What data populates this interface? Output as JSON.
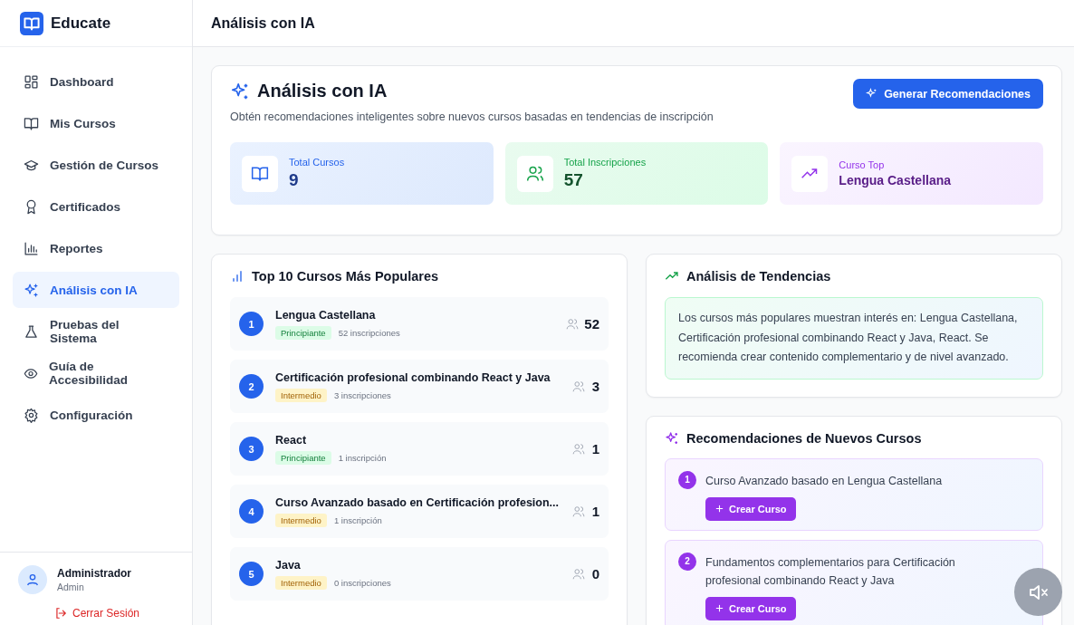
{
  "app": {
    "name": "Educate"
  },
  "sidebar": {
    "items": [
      {
        "label": "Dashboard",
        "selected": false
      },
      {
        "label": "Mis Cursos",
        "selected": false
      },
      {
        "label": "Gestión de Cursos",
        "selected": false
      },
      {
        "label": "Certificados",
        "selected": false
      },
      {
        "label": "Reportes",
        "selected": false
      },
      {
        "label": "Análisis con IA",
        "selected": true
      },
      {
        "label": "Pruebas del Sistema",
        "selected": false
      },
      {
        "label": "Guía de Accesibilidad",
        "selected": false
      },
      {
        "label": "Configuración",
        "selected": false
      }
    ],
    "user": {
      "name": "Administrador",
      "role": "Admin"
    },
    "logout": "Cerrar Sesión"
  },
  "header": {
    "title": "Análisis con IA"
  },
  "hero": {
    "title": "Análisis con IA",
    "subtitle": "Obtén recomendaciones inteligentes sobre nuevos cursos basadas en tendencias de inscripción",
    "button": "Generar Recomendaciones",
    "stats": [
      {
        "kind": "courses",
        "label": "Total Cursos",
        "value": "9"
      },
      {
        "kind": "enrollments",
        "label": "Total Inscripciones",
        "value": "57"
      },
      {
        "kind": "top",
        "label": "Curso Top",
        "value": "Lengua Castellana"
      }
    ]
  },
  "popular": {
    "title": "Top 10 Cursos Más Populares",
    "courses": [
      {
        "rank": "1",
        "title": "Lengua Castellana",
        "kind": "beginner",
        "difficulty": "Principiante",
        "enrollments": "52 inscripciones",
        "count": "52"
      },
      {
        "rank": "2",
        "title": "Certificación profesional combinando React y Java",
        "kind": "intermediate",
        "difficulty": "Intermedio",
        "enrollments": "3 inscripciones",
        "count": "3"
      },
      {
        "rank": "3",
        "title": "React",
        "kind": "beginner",
        "difficulty": "Principiante",
        "enrollments": "1 inscripción",
        "count": "1"
      },
      {
        "rank": "4",
        "title": "Curso Avanzado basado en Certificación profesion...",
        "kind": "intermediate",
        "difficulty": "Intermedio",
        "enrollments": "1 inscripción",
        "count": "1"
      },
      {
        "rank": "5",
        "title": "Java",
        "kind": "intermediate",
        "difficulty": "Intermedio",
        "enrollments": "0 inscripciones",
        "count": "0"
      }
    ]
  },
  "trends": {
    "title": "Análisis de Tendencias",
    "text": "Los cursos más populares muestran interés en: Lengua Castellana, Certificación profesional combinando React y Java, React. Se recomienda crear contenido complementario y de nivel avanzado."
  },
  "recommendations": {
    "title": "Recomendaciones de Nuevos Cursos",
    "items": [
      {
        "rank": "1",
        "text": "Curso Avanzado basado en Lengua Castellana",
        "button": "Crear Curso"
      },
      {
        "rank": "2",
        "text": "Fundamentos complementarios para Certificación profesional combinando React y Java",
        "button": "Crear Curso"
      }
    ]
  },
  "mute_button": {
    "muted": true
  }
}
